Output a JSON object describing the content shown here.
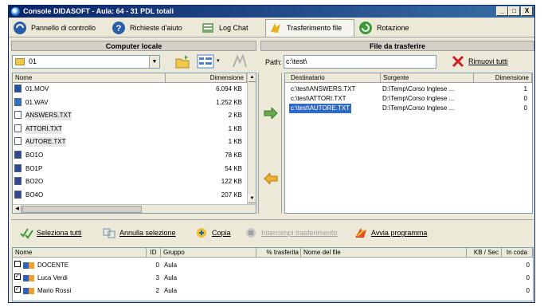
{
  "window": {
    "title": "Console DIDASOFT - Aula: 64 - 31 PDL totali",
    "min": "_",
    "max": "□",
    "close": "X"
  },
  "tabs": [
    {
      "label": "Pannello di controllo"
    },
    {
      "label": "Richieste d'aiuto"
    },
    {
      "label": "Log Chat"
    },
    {
      "label": "Trasferimento file"
    },
    {
      "label": "Rotazione"
    }
  ],
  "left": {
    "title": "Computer locale",
    "folder": "01",
    "columns": [
      "Nome",
      "Dimensione"
    ],
    "files": [
      {
        "name": "01.MOV",
        "size": "6.094 KB",
        "icon": "movie-file-icon"
      },
      {
        "name": "01.WAV",
        "size": "1.252 KB",
        "icon": "audio-file-icon"
      },
      {
        "name": "ANSWERS.TXT",
        "size": "2 KB",
        "icon": "text-file-icon"
      },
      {
        "name": "ATTORI.TXT",
        "size": "1 KB",
        "icon": "text-file-icon"
      },
      {
        "name": "AUTORE.TXT",
        "size": "1 KB",
        "icon": "text-file-icon"
      },
      {
        "name": "BO1O",
        "size": "78 KB",
        "icon": "image-file-icon"
      },
      {
        "name": "BO1P",
        "size": "54 KB",
        "icon": "image-file-icon"
      },
      {
        "name": "BO2O",
        "size": "122 KB",
        "icon": "image-file-icon"
      },
      {
        "name": "BO4O",
        "size": "207 KB",
        "icon": "image-file-icon"
      }
    ]
  },
  "right": {
    "title": "File da trasferire",
    "path_label": "Path:",
    "path_value": "c:\\test\\",
    "remove_all": "Rimuovi tutti",
    "columns": [
      "Destinatario",
      "Sorgente",
      "Dimensione"
    ],
    "transfers": [
      {
        "dest": "c:\\test\\ANSWERS.TXT",
        "src": "D:\\Temp\\Corso Inglese ...",
        "size": "1"
      },
      {
        "dest": "c:\\test\\ATTORI.TXT",
        "src": "D:\\Temp\\Corso Inglese ...",
        "size": "0"
      },
      {
        "dest": "c:\\test\\AUTORE.TXT",
        "src": "D:\\Temp\\Corso Inglese ...",
        "size": "0"
      }
    ]
  },
  "toolbar": {
    "select_all": "Seleziona tutti",
    "deselect": "Annulla selezione",
    "copy": "Copia",
    "interrupt": "Interrompi trasferimento",
    "launch": "Avvia programma"
  },
  "students": {
    "columns": [
      "Nome",
      "ID",
      "Gruppo",
      "% trasferita",
      "Nome del file",
      "KB / Sec",
      "In coda"
    ],
    "rows": [
      {
        "name": "DOCENTE",
        "id": "0",
        "group": "Aula",
        "queue": "0",
        "checked": false
      },
      {
        "name": "Luca Verdi",
        "id": "3",
        "group": "Aula",
        "queue": "0",
        "checked": true
      },
      {
        "name": "Mario Rossi",
        "id": "2",
        "group": "Aula",
        "queue": "0",
        "checked": true
      }
    ]
  }
}
